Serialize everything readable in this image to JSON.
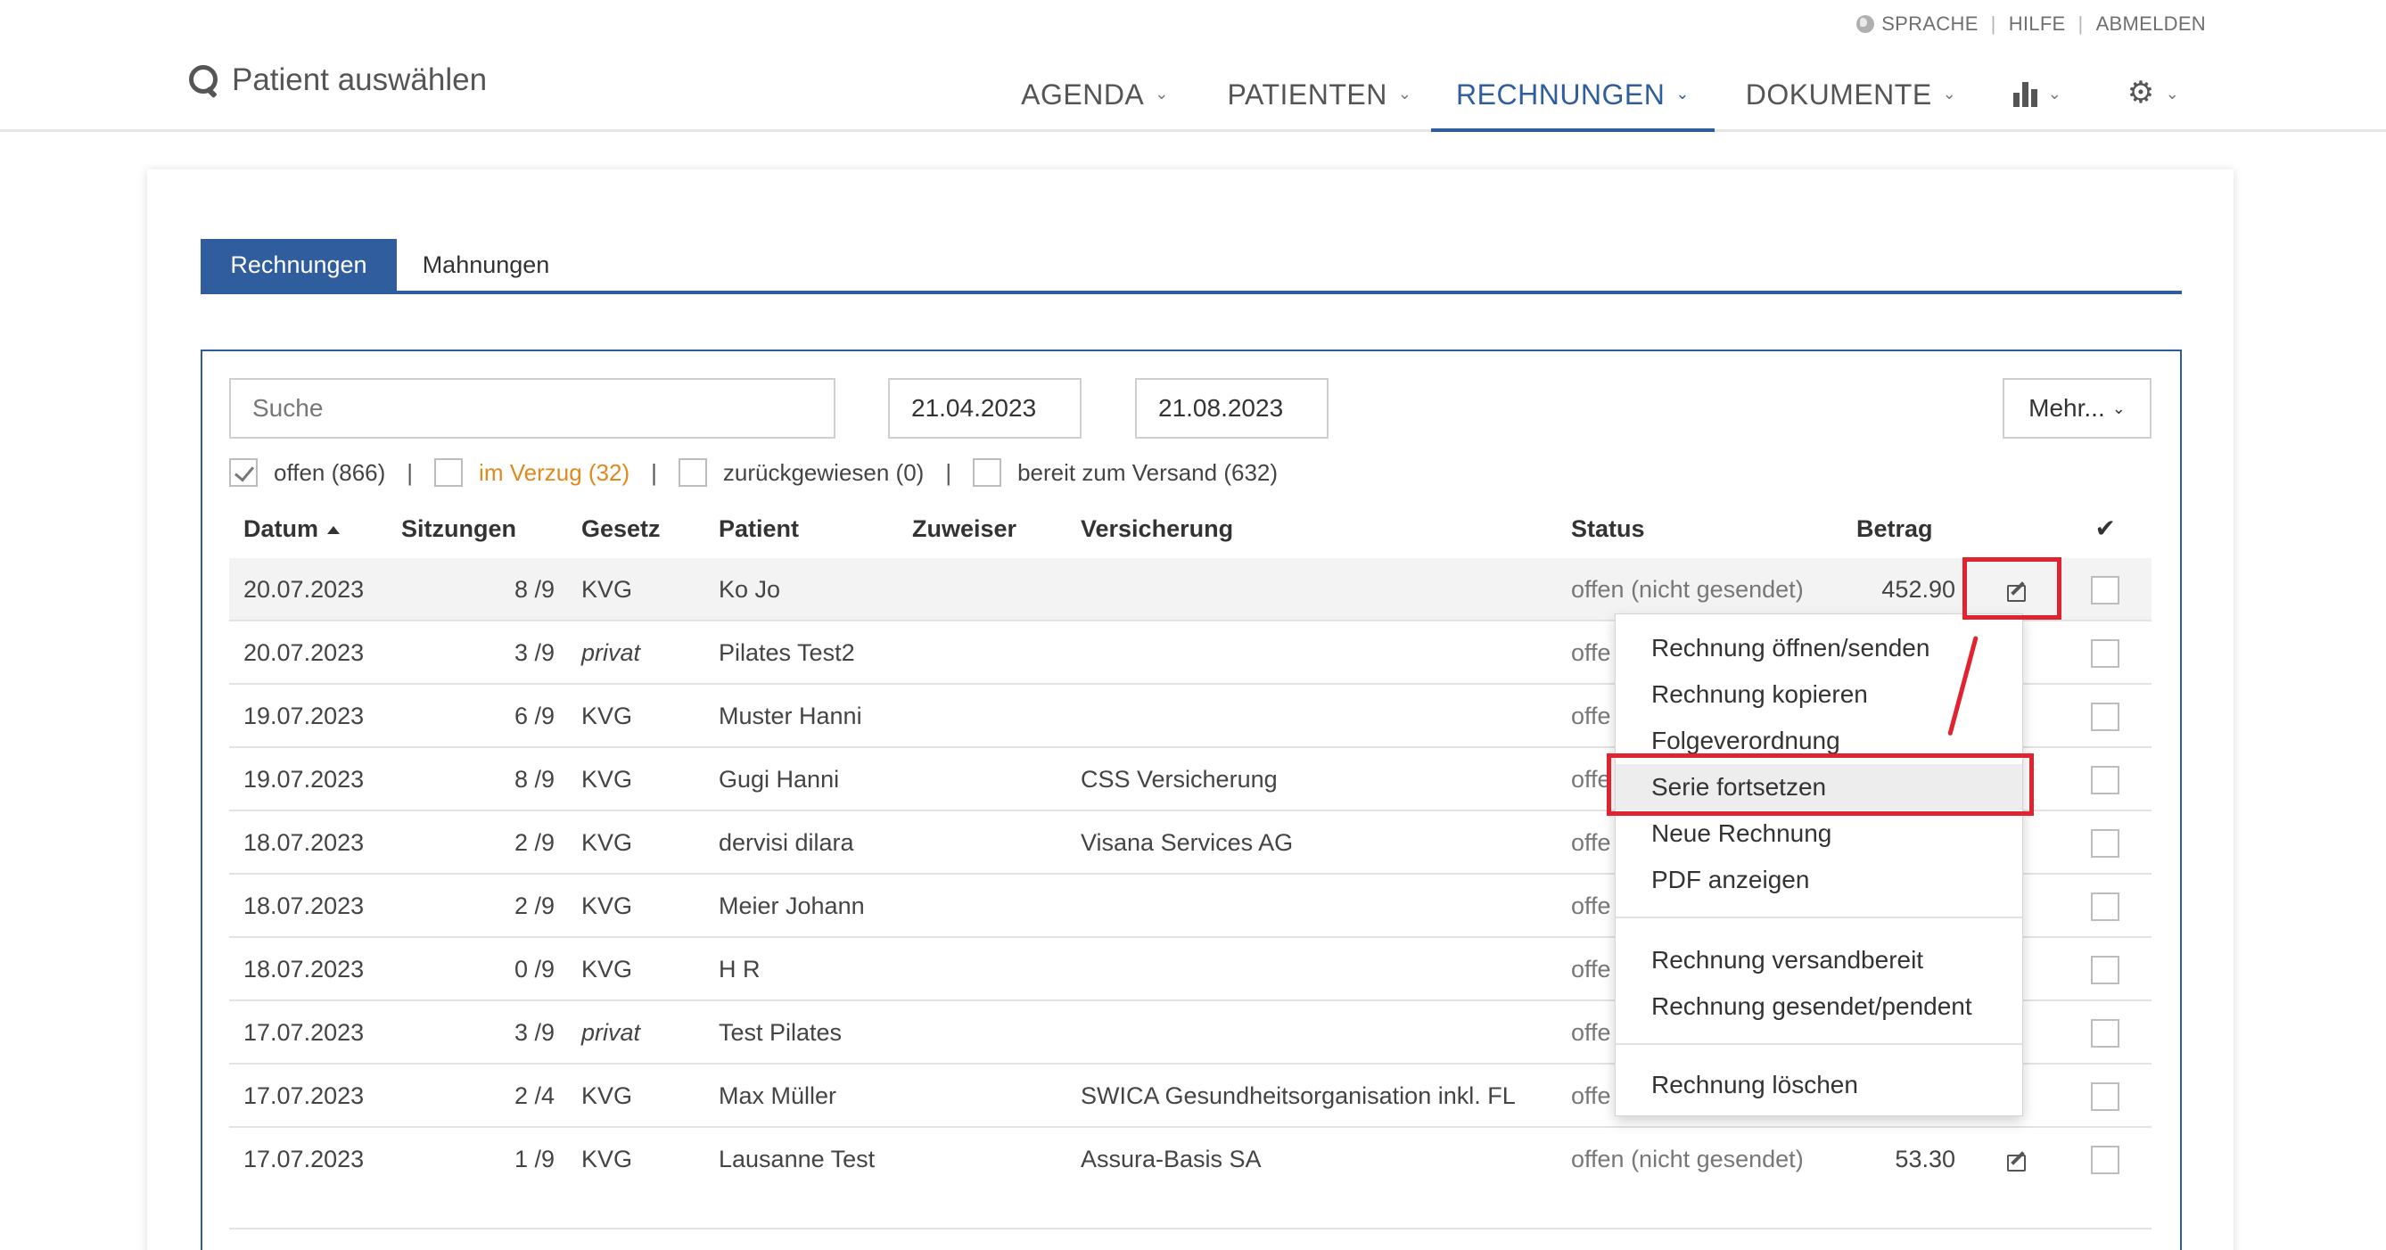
{
  "topbar": {
    "language": "SPRACHE",
    "help": "HILFE",
    "logout": "ABMELDEN",
    "patient_select": "Patient auswählen",
    "nav": {
      "agenda": "AGENDA",
      "patienten": "PATIENTEN",
      "rechnungen": "RECHNUNGEN",
      "dokumente": "DOKUMENTE"
    },
    "nav_icons": [
      "bar-chart-icon",
      "gear-icon"
    ],
    "active_nav": "RECHNUNGEN"
  },
  "tabs": {
    "rechnungen": "Rechnungen",
    "mahnungen": "Mahnungen"
  },
  "filters": {
    "search_placeholder": "Suche",
    "date_from": "21.04.2023",
    "date_to": "21.08.2023",
    "more": "Mehr...",
    "status": [
      {
        "label": "offen (866)",
        "checked": true
      },
      {
        "label": "im Verzug (32)",
        "checked": false
      },
      {
        "label": "zurückgewiesen (0)",
        "checked": false
      },
      {
        "label": "bereit zum Versand (632)",
        "checked": false
      }
    ]
  },
  "table": {
    "headers": {
      "datum": "Datum",
      "sitzungen": "Sitzungen",
      "gesetz": "Gesetz",
      "patient": "Patient",
      "zuweiser": "Zuweiser",
      "versicherung": "Versicherung",
      "status": "Status",
      "betrag": "Betrag"
    },
    "rows": [
      {
        "datum": "20.07.2023",
        "sitzungen": "8 /9",
        "gesetz": "KVG",
        "patient": "Ko Jo",
        "versicherung": "",
        "status": "offen (nicht gesendet)",
        "betrag": "452.90"
      },
      {
        "datum": "20.07.2023",
        "sitzungen": "3 /9",
        "gesetz": "privat",
        "patient": "Pilates Test2",
        "versicherung": "",
        "status": "offe",
        "betrag": ""
      },
      {
        "datum": "19.07.2023",
        "sitzungen": "6 /9",
        "gesetz": "KVG",
        "patient": "Muster Hanni",
        "versicherung": "",
        "status": "offe",
        "betrag": ""
      },
      {
        "datum": "19.07.2023",
        "sitzungen": "8 /9",
        "gesetz": "KVG",
        "patient": "Gugi Hanni",
        "versicherung": "CSS Versicherung",
        "status": "offe",
        "betrag": ""
      },
      {
        "datum": "18.07.2023",
        "sitzungen": "2 /9",
        "gesetz": "KVG",
        "patient": "dervisi dilara",
        "versicherung": "Visana Services AG",
        "status": "offe",
        "betrag": ""
      },
      {
        "datum": "18.07.2023",
        "sitzungen": "2 /9",
        "gesetz": "KVG",
        "patient": "Meier Johann",
        "versicherung": "",
        "status": "offe",
        "betrag": ""
      },
      {
        "datum": "18.07.2023",
        "sitzungen": "0 /9",
        "gesetz": "KVG",
        "patient": "H R",
        "versicherung": "",
        "status": "offe",
        "betrag": ""
      },
      {
        "datum": "17.07.2023",
        "sitzungen": "3 /9",
        "gesetz": "privat",
        "patient": "Test Pilates",
        "versicherung": "",
        "status": "offe",
        "betrag": ""
      },
      {
        "datum": "17.07.2023",
        "sitzungen": "2 /4",
        "gesetz": "KVG",
        "patient": "Max Müller",
        "versicherung": "SWICA Gesundheitsorganisation inkl. FL",
        "status": "offe",
        "betrag": ""
      },
      {
        "datum": "17.07.2023",
        "sitzungen": "1 /9",
        "gesetz": "KVG",
        "patient": "Lausanne Test",
        "versicherung": "Assura-Basis SA",
        "status": "offen (nicht gesendet)",
        "betrag": "53.30"
      }
    ]
  },
  "context_menu": {
    "items": [
      "Rechnung öffnen/senden",
      "Rechnung kopieren",
      "Folgeverordnung",
      "Serie fortsetzen",
      "Neue Rechnung",
      "PDF anzeigen",
      "Rechnung versandbereit",
      "Rechnung gesendet/pendent",
      "Rechnung löschen"
    ],
    "highlighted": "Serie fortsetzen"
  },
  "colors": {
    "accent": "#2f5d9d",
    "warning": "#e08a1e",
    "annotation": "#e0232e"
  }
}
